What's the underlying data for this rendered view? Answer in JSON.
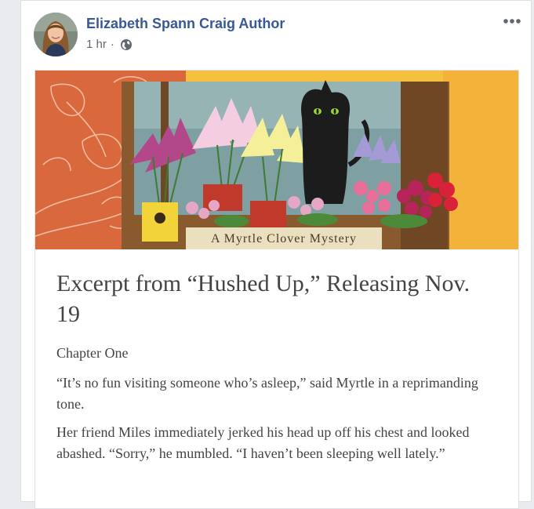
{
  "post": {
    "author_name": "Elizabeth Spann Craig Author",
    "timestamp": "1 hr",
    "separator": "·",
    "privacy_icon": "globe-icon",
    "more_icon": "more-horizontal-icon"
  },
  "link_card": {
    "banner_caption": "A Myrtle Clover Mystery",
    "title": "Excerpt from “Hushed Up,” Releasing Nov. 19",
    "chapter": "Chapter One",
    "paragraphs": [
      "“It’s no fun visiting someone who’s asleep,” said Myrtle in a reprimanding tone.",
      "Her friend Miles immediately jerked his head up off his chest and looked abashed. “Sorry,” he mumbled. “I haven’t been sleeping well lately.”"
    ]
  },
  "colors": {
    "author_link": "#385898",
    "meta_text": "#616770",
    "banner_orange": "#d9693c",
    "banner_yellow": "#f6c03f",
    "body_text": "#444444"
  }
}
